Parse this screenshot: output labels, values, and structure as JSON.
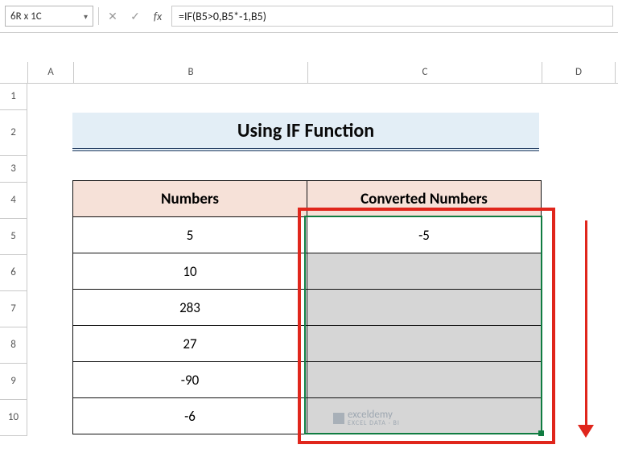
{
  "name_box": "6R x 1C",
  "formula": "=IF(B5>0,B5*-1,B5)",
  "col_headers": {
    "a": "A",
    "b": "B",
    "c": "C",
    "d": "D"
  },
  "row_headers": [
    "1",
    "2",
    "3",
    "4",
    "5",
    "6",
    "7",
    "8",
    "9",
    "10"
  ],
  "title": "Using IF Function",
  "table_headers": {
    "numbers": "Numbers",
    "converted": "Converted Numbers"
  },
  "rows": [
    {
      "num": "5",
      "conv": "-5"
    },
    {
      "num": "10",
      "conv": ""
    },
    {
      "num": "283",
      "conv": ""
    },
    {
      "num": "27",
      "conv": ""
    },
    {
      "num": "-90",
      "conv": ""
    },
    {
      "num": "-6",
      "conv": ""
    }
  ],
  "watermark": {
    "brand": "exceldemy",
    "tag": "EXCEL DATA · BI"
  },
  "chart_data": {
    "type": "table",
    "title": "Using IF Function",
    "columns": [
      "Numbers",
      "Converted Numbers"
    ],
    "data": [
      [
        5,
        -5
      ],
      [
        10,
        null
      ],
      [
        283,
        null
      ],
      [
        27,
        null
      ],
      [
        -90,
        null
      ],
      [
        -6,
        null
      ]
    ],
    "formula_for_converted": "=IF(B5>0,B5*-1,B5)"
  }
}
